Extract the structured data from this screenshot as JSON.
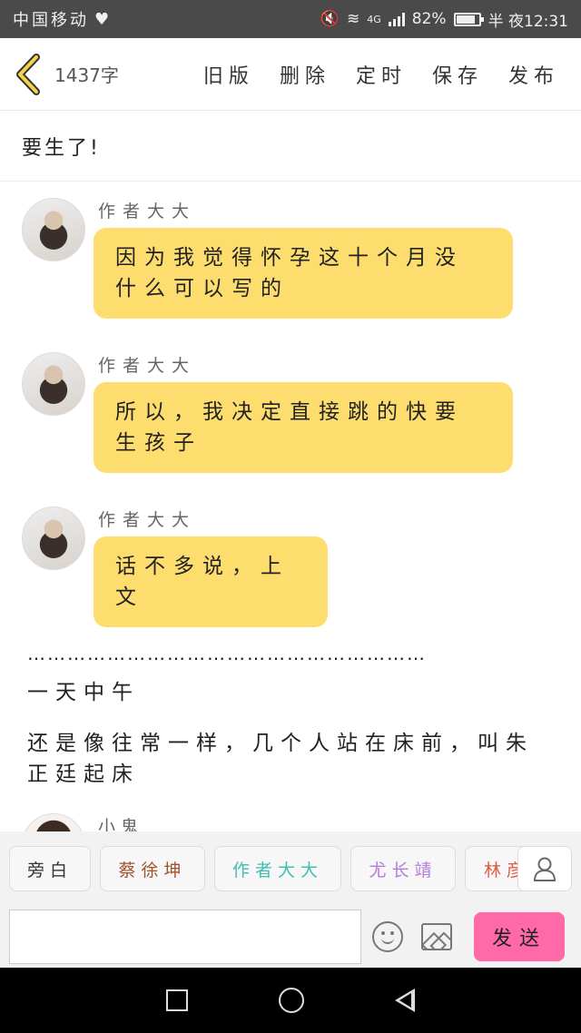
{
  "status": {
    "carrier": "中国移动",
    "network": "4G",
    "battery": "82%",
    "time": "半 夜12:31"
  },
  "header": {
    "word_count": "1437字",
    "actions": [
      "旧版",
      "删除",
      "定时",
      "保存",
      "发布"
    ]
  },
  "content": {
    "chapter_line": "要生了!",
    "messages": [
      {
        "author": "作者大大",
        "text": "因为我觉得怀孕这十个月没什么可以写的"
      },
      {
        "author": "作者大大",
        "text": "所以，我决定直接跳的快要生孩子"
      },
      {
        "author": "作者大大",
        "text": "话不多说，上文"
      }
    ],
    "separator": "……………………………………………………",
    "paragraphs": [
      "一天中午",
      "还是像往常一样，几个人站在床前，叫朱正廷起床"
    ],
    "partial_message_author": "小鬼"
  },
  "roles": [
    "旁白",
    "蔡徐坤",
    "作者大大",
    "尤长靖",
    "林彦"
  ],
  "composer": {
    "input_value": "",
    "send_label": "发送"
  },
  "colors": {
    "bubble": "#fddd6d",
    "send_button": "#ff69a8",
    "status_bar": "#4a4a4a"
  }
}
